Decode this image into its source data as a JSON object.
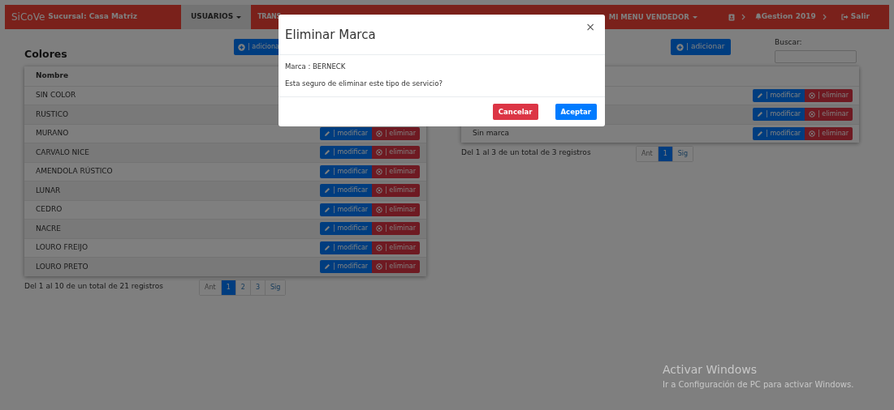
{
  "navbar": {
    "brand": "SiCoVe",
    "branch": "Sucursal: Casa Matriz",
    "menu": [
      {
        "label": "USUARIOS",
        "dropdown": true,
        "selected": true
      },
      {
        "label": "TRANS",
        "selected": false
      }
    ],
    "user_menu": {
      "label": "MI MENU VENDEDOR",
      "dropdown": true
    },
    "gestion": "Gestion 2019",
    "logout": "Salir"
  },
  "left_panel": {
    "title": "Colores",
    "add_button": "| adiciona",
    "table": {
      "columns": [
        "Nombre"
      ],
      "rows": [
        {
          "name": "SIN COLOR"
        },
        {
          "name": "RUSTICO"
        },
        {
          "name": "MURANO",
          "edit": "| modificar",
          "delete": "| eliminar"
        },
        {
          "name": "CARVALO NICE",
          "edit": "| modificar",
          "delete": "| eliminar"
        },
        {
          "name": "AMENDOLA RÚSTICO",
          "edit": "| modificar",
          "delete": "| eliminar"
        },
        {
          "name": "LUNAR",
          "edit": "| modificar",
          "delete": "| eliminar"
        },
        {
          "name": "CEDRO",
          "edit": "| modificar",
          "delete": "| eliminar"
        },
        {
          "name": "NACRE",
          "edit": "| modificar",
          "delete": "| eliminar"
        },
        {
          "name": "LOURO FREIJO",
          "edit": "| modificar",
          "delete": "| eliminar"
        },
        {
          "name": "LOURO PRETO",
          "edit": "| modificar",
          "delete": "| eliminar"
        }
      ]
    },
    "summary": "Del 1 al 10 de un total de 21 registros",
    "pagination": [
      {
        "label": "Ant",
        "selected": false
      },
      {
        "label": "1",
        "selected": true
      },
      {
        "label": "2",
        "selected": false
      },
      {
        "label": "3",
        "selected": false
      },
      {
        "label": "Sig",
        "selected": false
      }
    ]
  },
  "right_panel": {
    "add_button": "| adicionar",
    "search": {
      "label": "Buscar:"
    },
    "table": {
      "rows": [
        {
          "edit": "| modificar",
          "delete": "| eliminar"
        },
        {
          "edit": "| modificar",
          "delete": "| eliminar"
        },
        {
          "name": "Sin marca",
          "edit": "| modificar",
          "delete": "| eliminar"
        }
      ]
    },
    "summary": "Del 1 al 3 de un total de 3 registros",
    "pagination": [
      {
        "label": "Ant",
        "selected": false
      },
      {
        "label": "1",
        "selected": true
      },
      {
        "label": "Sig",
        "selected": false
      }
    ]
  },
  "modal": {
    "title": "Eliminar Marca",
    "close": "×",
    "lines": [
      "Marca : BERNECK",
      "Esta seguro de eliminar este tipo de servicio?"
    ],
    "buttons": [
      {
        "label": "Cancelar",
        "kind": "danger"
      },
      {
        "label": "Aceptar",
        "kind": "primary"
      }
    ]
  },
  "os_notice": {
    "title": "Activar Windows",
    "text": "Ir a Configuración de PC para activar Windows."
  }
}
